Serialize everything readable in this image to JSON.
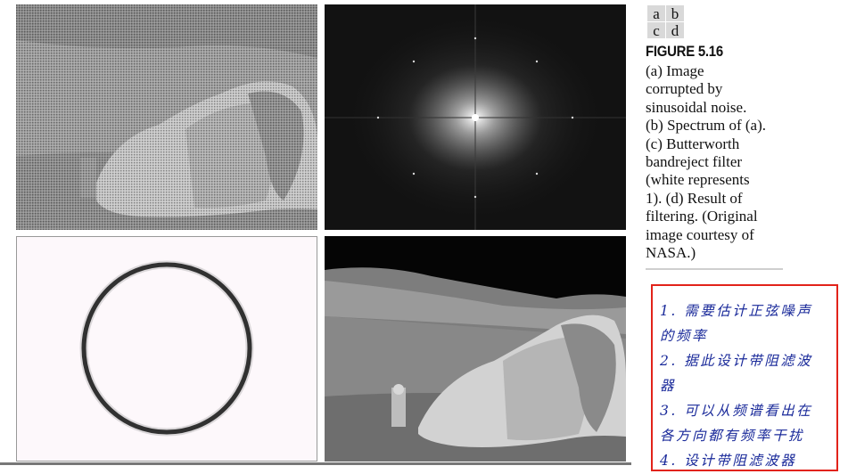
{
  "subfigure_key": [
    "a",
    "b",
    "c",
    "d"
  ],
  "caption": {
    "figure_label": "FIGURE 5.16",
    "lines": [
      "(a) Image",
      "corrupted by",
      "sinusoidal noise.",
      "(b) Spectrum of (a).",
      "(c) Butterworth",
      "bandreject filter",
      "(white represents",
      "1). (d) Result of",
      "filtering. (Original",
      "image courtesy of",
      "NASA.)"
    ]
  },
  "notes": {
    "lines": [
      "1. 需要估计正弦噪声",
      "的频率",
      "2. 据此设计带阻滤波",
      "器",
      "3. 可以从频谱看出在",
      "各方向都有频率干扰",
      "4. 设计带阻滤波器"
    ],
    "border_color": "#e2231a",
    "text_color": "#1a2a9a"
  },
  "panels": {
    "a": "moon-rock-image-with-sinusoidal-noise",
    "b": "fourier-spectrum-image",
    "c": "butterworth-bandreject-filter-ring",
    "d": "filtered-moon-rock-image"
  }
}
